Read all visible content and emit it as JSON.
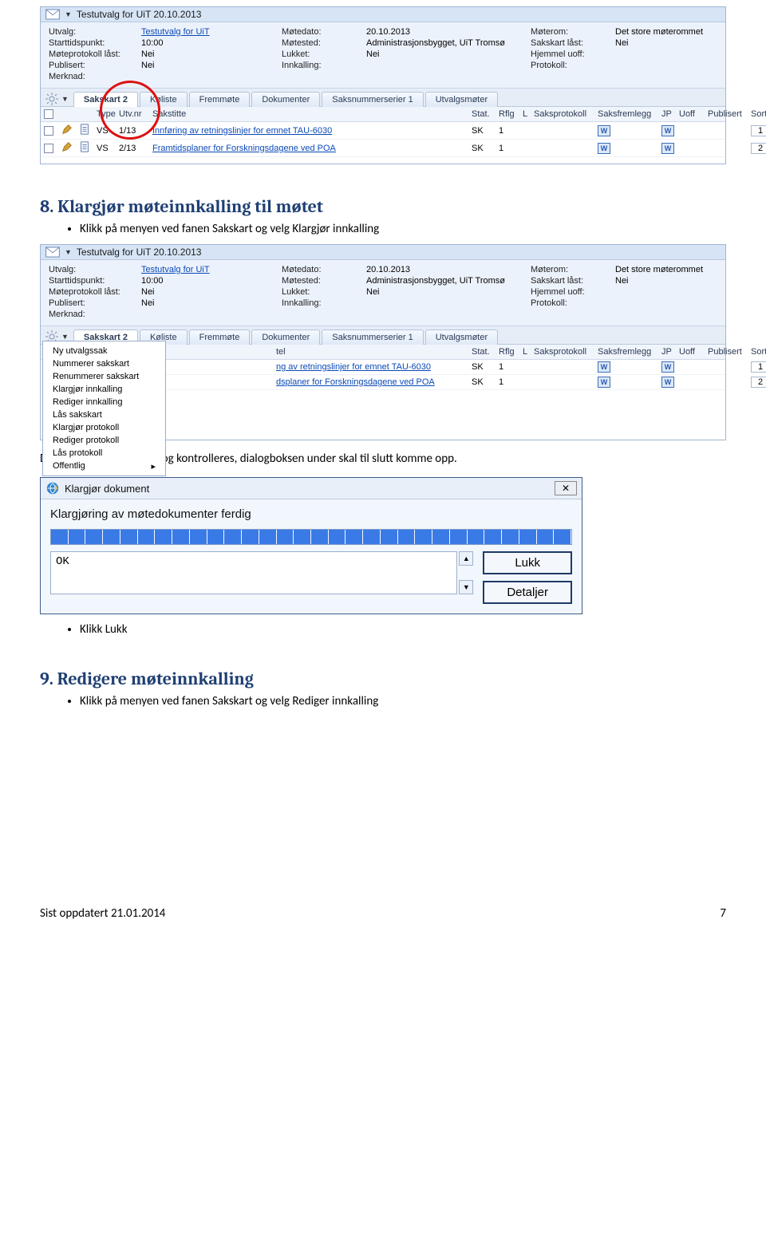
{
  "app1": {
    "titlebar": "Testutvalg for UiT    20.10.2013",
    "meta": {
      "utvalg_label": "Utvalg:",
      "utvalg_value": "Testutvalg for UiT",
      "starttid_label": "Starttidspunkt:",
      "starttid_value": "10:00",
      "moteprotokoll_label": "Møteprotokoll låst:",
      "moteprotokoll_value": "Nei",
      "publisert_label": "Publisert:",
      "publisert_value": "Nei",
      "merknad_label": "Merknad:",
      "motedato_label": "Møtedato:",
      "motedato_value": "20.10.2013",
      "motested_label": "Møtested:",
      "motested_value": "Administrasjonsbygget, UiT Tromsø",
      "lukket_label": "Lukket:",
      "lukket_value": "Nei",
      "innkalling_label": "Innkalling:",
      "moterom_label": "Møterom:",
      "moterom_value": "Det store møterommet",
      "sakskart_last_label": "Sakskart låst:",
      "sakskart_last_value": "Nei",
      "hjemmel_label": "Hjemmel uoff:",
      "protokoll_label": "Protokoll:"
    },
    "tabs": [
      "Sakskart 2",
      "Køliste",
      "Fremmøte",
      "Dokumenter",
      "Saksnummerserier 1",
      "Utvalgsmøter"
    ],
    "columns": {
      "type": "Type",
      "utvnr": "Utv.nr",
      "sakstitte": "Sakstitte",
      "stat": "Stat.",
      "rflg": "Rflg",
      "l": "L",
      "saksprotokoll": "Saksprotokoll",
      "saksfremlegg": "Saksfremlegg",
      "jp": "JP",
      "uoff": "Uoff",
      "publisert": "Publisert",
      "sort": "Sort"
    },
    "rows": [
      {
        "type": "VS",
        "utvnr": "1/13",
        "title": "Innføring av retningslinjer for emnet TAU-6030",
        "stat": "SK",
        "rflg": "1",
        "sort": "1"
      },
      {
        "type": "VS",
        "utvnr": "2/13",
        "title": "Framtidsplaner for Forskningsdagene ved POA",
        "stat": "SK",
        "rflg": "1",
        "sort": "2"
      }
    ]
  },
  "section8": {
    "heading": "8. Klargjør møteinnkalling til møtet",
    "bullet1": "Klikk på menyen ved fanen Sakskart og velg Klargjør innkalling"
  },
  "app2": {
    "menu": [
      "Ny utvalgssak",
      "Nummerer sakskart",
      "Renummerer sakskart",
      "Klargjør innkalling",
      "Rediger innkalling",
      "Lås sakskart",
      "Klargjør protokoll",
      "Rediger protokoll",
      "Lås protokoll",
      "Offentlig"
    ],
    "rows_partial": [
      {
        "title_suffix": "ng av retningslinjer for emnet TAU-6030",
        "stat": "SK",
        "rflg": "1",
        "sort": "1"
      },
      {
        "title_suffix": "dsplaner for Forskningsdagene ved POA",
        "stat": "SK",
        "rflg": "1",
        "sort": "2"
      }
    ]
  },
  "interlude": "Dokumentene klargjøres og kontrolleres, dialogboksen under skal til slutt komme opp.",
  "dialog": {
    "title": "Klargjør dokument",
    "msg": "Klargjøring av møtedokumenter ferdig",
    "result": "OK",
    "btn_lukk": "Lukk",
    "btn_detaljer": "Detaljer"
  },
  "after_dialog_bullet": "Klikk Lukk",
  "section9": {
    "heading": "9. Redigere møteinnkalling",
    "bullet1": "Klikk på menyen ved fanen Sakskart og velg Rediger innkalling"
  },
  "footer": {
    "left": "Sist oppdatert 21.01.2014",
    "right": "7"
  }
}
